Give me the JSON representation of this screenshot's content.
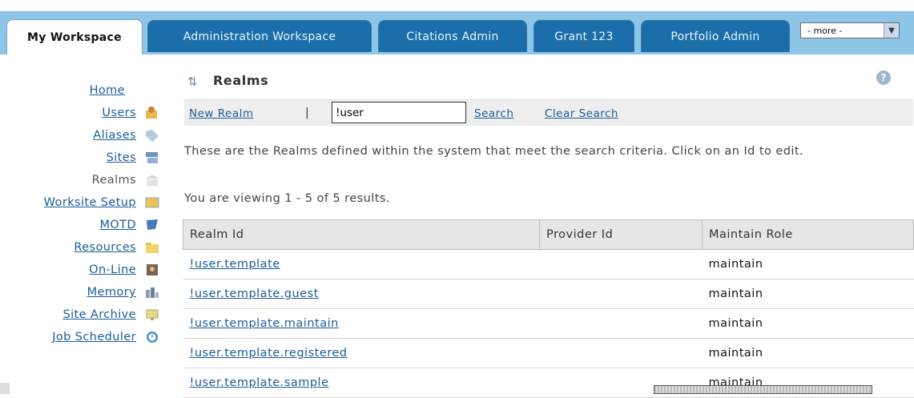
{
  "tabs": [
    {
      "label": "My Workspace",
      "active": true
    },
    {
      "label": "Administration Workspace",
      "active": false
    },
    {
      "label": "Citations Admin",
      "active": false
    },
    {
      "label": "Grant 123",
      "active": false
    },
    {
      "label": "Portfolio Admin",
      "active": false
    }
  ],
  "more_select": {
    "value": "- more -"
  },
  "nav": [
    {
      "label": "Home",
      "icon": "none",
      "current": false
    },
    {
      "label": "Users",
      "icon": "users-icon",
      "current": false
    },
    {
      "label": "Aliases",
      "icon": "tag-icon",
      "current": false
    },
    {
      "label": "Sites",
      "icon": "sites-icon",
      "current": false
    },
    {
      "label": "Realms",
      "icon": "realms-icon",
      "current": true
    },
    {
      "label": "Worksite Setup",
      "icon": "worksite-icon",
      "current": false
    },
    {
      "label": "MOTD",
      "icon": "flag-icon",
      "current": false
    },
    {
      "label": "Resources",
      "icon": "folder-icon",
      "current": false
    },
    {
      "label": "On-Line",
      "icon": "person-icon",
      "current": false
    },
    {
      "label": "Memory",
      "icon": "memory-icon",
      "current": false
    },
    {
      "label": "Site Archive",
      "icon": "archive-icon",
      "current": false
    },
    {
      "label": "Job Scheduler",
      "icon": "clock-icon",
      "current": false
    }
  ],
  "main": {
    "title": "Realms",
    "toolbar": {
      "new_realm": "New Realm",
      "separator": "|",
      "search_value": "!user",
      "search": "Search",
      "clear_search": "Clear Search"
    },
    "description": "These are the Realms defined within the system that meet the search criteria. Click on an Id to edit.",
    "viewing": "You are viewing 1 - 5 of 5 results.",
    "table": {
      "headers": [
        "Realm Id",
        "Provider Id",
        "Maintain Role"
      ],
      "rows": [
        {
          "realm_id": "!user.template",
          "provider_id": "",
          "maintain_role": "maintain"
        },
        {
          "realm_id": "!user.template.guest",
          "provider_id": "",
          "maintain_role": "maintain"
        },
        {
          "realm_id": "!user.template.maintain",
          "provider_id": "",
          "maintain_role": "maintain"
        },
        {
          "realm_id": "!user.template.registered",
          "provider_id": "",
          "maintain_role": "maintain"
        },
        {
          "realm_id": "!user.template.sample",
          "provider_id": "",
          "maintain_role": "maintain"
        }
      ]
    }
  },
  "colors": {
    "tab_bar": "#8ec5e6",
    "tab": "#1b6ea8",
    "link": "#1a5c9a",
    "header_bg": "#e6e6e6"
  }
}
